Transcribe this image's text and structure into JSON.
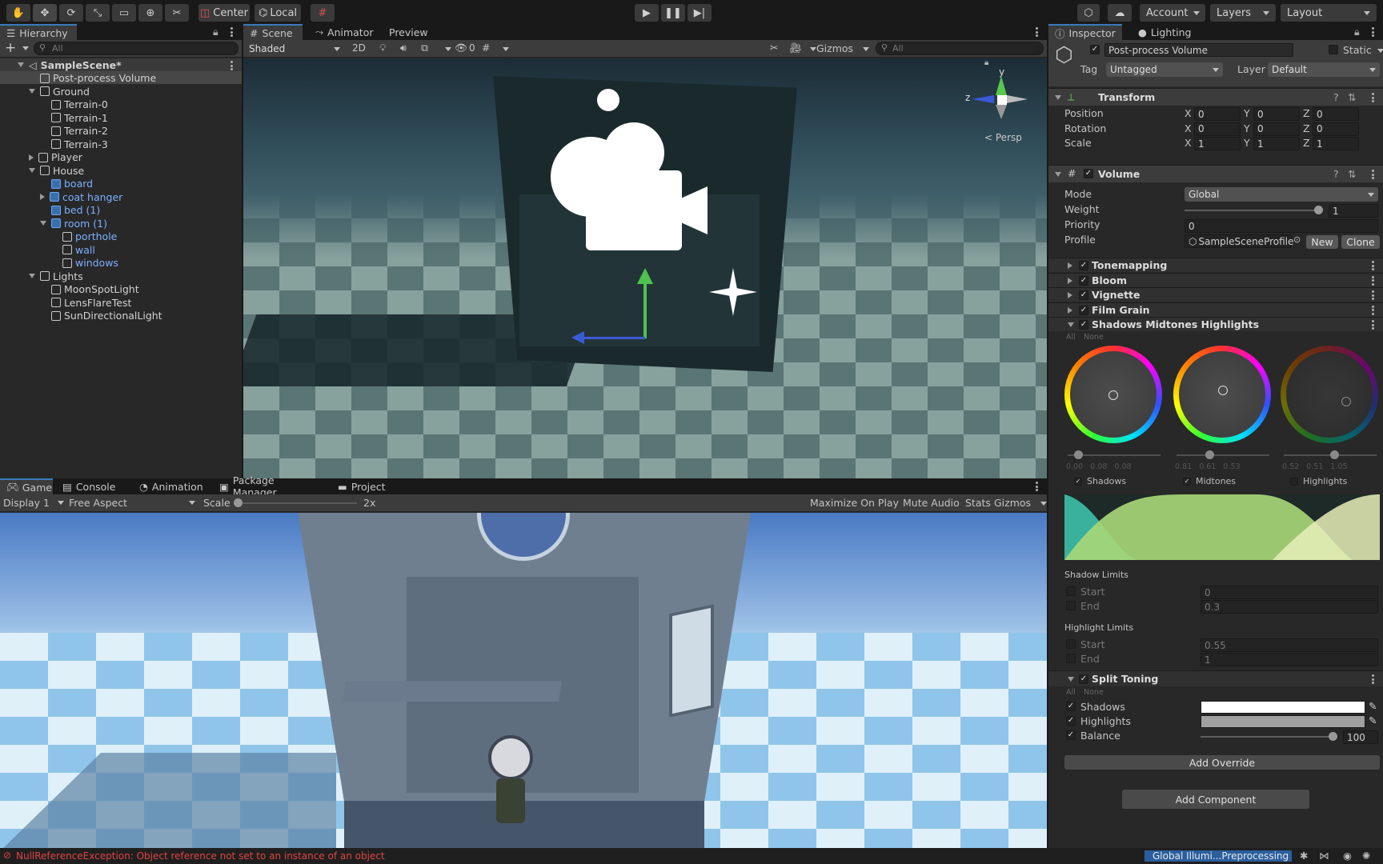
{
  "toolbar": {
    "pivot": "Center",
    "space": "Local",
    "account": "Account",
    "layers": "Layers",
    "layout": "Layout"
  },
  "hierarchy": {
    "tab": "Hierarchy",
    "search_placeholder": "All",
    "items": [
      {
        "label": "SampleScene*",
        "depth": 0,
        "expand": "down",
        "kind": "scene"
      },
      {
        "label": "Post-process Volume",
        "depth": 1,
        "kind": "cube"
      },
      {
        "label": "Ground",
        "depth": 1,
        "expand": "down",
        "kind": "cube"
      },
      {
        "label": "Terrain-0",
        "depth": 2,
        "kind": "cube"
      },
      {
        "label": "Terrain-1",
        "depth": 2,
        "kind": "cube"
      },
      {
        "label": "Terrain-2",
        "depth": 2,
        "kind": "cube"
      },
      {
        "label": "Terrain-3",
        "depth": 2,
        "kind": "cube"
      },
      {
        "label": "Player",
        "depth": 1,
        "expand": "right",
        "kind": "cube"
      },
      {
        "label": "House",
        "depth": 1,
        "expand": "down",
        "kind": "cube"
      },
      {
        "label": "board",
        "depth": 2,
        "kind": "prefab"
      },
      {
        "label": "coat hanger",
        "depth": 2,
        "expand": "right",
        "kind": "prefab"
      },
      {
        "label": "bed (1)",
        "depth": 2,
        "kind": "prefab"
      },
      {
        "label": "room (1)",
        "depth": 2,
        "expand": "down",
        "kind": "prefab"
      },
      {
        "label": "porthole",
        "depth": 3,
        "kind": "prefab-child"
      },
      {
        "label": "wall",
        "depth": 3,
        "kind": "prefab-child"
      },
      {
        "label": "windows",
        "depth": 3,
        "kind": "prefab-child"
      },
      {
        "label": "Lights",
        "depth": 1,
        "expand": "down",
        "kind": "cube"
      },
      {
        "label": "MoonSpotLight",
        "depth": 2,
        "kind": "cube"
      },
      {
        "label": "LensFlareTest",
        "depth": 2,
        "kind": "cube"
      },
      {
        "label": "SunDirectionalLight",
        "depth": 2,
        "kind": "cube"
      }
    ]
  },
  "scene": {
    "tabs": [
      "Scene",
      "Animator",
      "Preview"
    ],
    "shading": "Shaded",
    "mode2d": "2D",
    "hidden_count": "0",
    "gizmos": "Gizmos",
    "search_placeholder": "All",
    "persp": "Persp",
    "axis_y": "y",
    "axis_z": "z"
  },
  "game": {
    "tabs": [
      "Game",
      "Console",
      "Animation",
      "Package Manager",
      "Project"
    ],
    "display": "Display 1",
    "aspect": "Free Aspect",
    "scale_label": "Scale",
    "scale_value": "2x",
    "maximize": "Maximize On Play",
    "mute": "Mute Audio",
    "stats": "Stats",
    "gizmos": "Gizmos"
  },
  "inspector": {
    "tabs": [
      "Inspector",
      "Lighting"
    ],
    "object_name": "Post-process Volume",
    "static_label": "Static",
    "tag_label": "Tag",
    "tag_value": "Untagged",
    "layer_label": "Layer",
    "layer_value": "Default",
    "transform": {
      "title": "Transform",
      "rows": [
        {
          "label": "Position",
          "x": "0",
          "y": "0",
          "z": "0"
        },
        {
          "label": "Rotation",
          "x": "0",
          "y": "0",
          "z": "0"
        },
        {
          "label": "Scale",
          "x": "1",
          "y": "1",
          "z": "1"
        }
      ]
    },
    "volume": {
      "title": "Volume",
      "mode_label": "Mode",
      "mode_value": "Global",
      "weight_label": "Weight",
      "weight_value": "1",
      "priority_label": "Priority",
      "priority_value": "0",
      "profile_label": "Profile",
      "profile_value": "SampleSceneProfile",
      "new_btn": "New",
      "clone_btn": "Clone"
    },
    "overrides": [
      "Tonemapping",
      "Bloom",
      "Vignette",
      "Film Grain",
      "Shadows Midtones Highlights"
    ],
    "all": "All",
    "none": "None",
    "wheels": [
      {
        "label": "Shadows",
        "values": "0.00   0.08   0.08"
      },
      {
        "label": "Midtones",
        "values": "0.81   0.61   0.53"
      },
      {
        "label": "Highlights",
        "values": "0.52   0.51   1.05"
      }
    ],
    "shadow_limits": {
      "title": "Shadow Limits",
      "start_label": "Start",
      "start": "0",
      "end_label": "End",
      "end": "0.3"
    },
    "highlight_limits": {
      "title": "Highlight Limits",
      "start_label": "Start",
      "start": "0.55",
      "end_label": "End",
      "end": "1"
    },
    "split_toning": {
      "title": "Split Toning",
      "shadows_label": "Shadows",
      "highlights_label": "Highlights",
      "balance_label": "Balance",
      "balance_value": "100",
      "shadows_color": "#ffffff",
      "highlights_color": "#a0a0a0"
    },
    "add_override": "Add Override",
    "add_component": "Add Component"
  },
  "status": {
    "error": "NullReferenceException: Object reference not set to an instance of an object",
    "progress": "Global Illumi...Preprocessing"
  },
  "colors": {
    "accent": "#3a79bb",
    "error": "#e04040",
    "prefab": "#7cafff"
  }
}
